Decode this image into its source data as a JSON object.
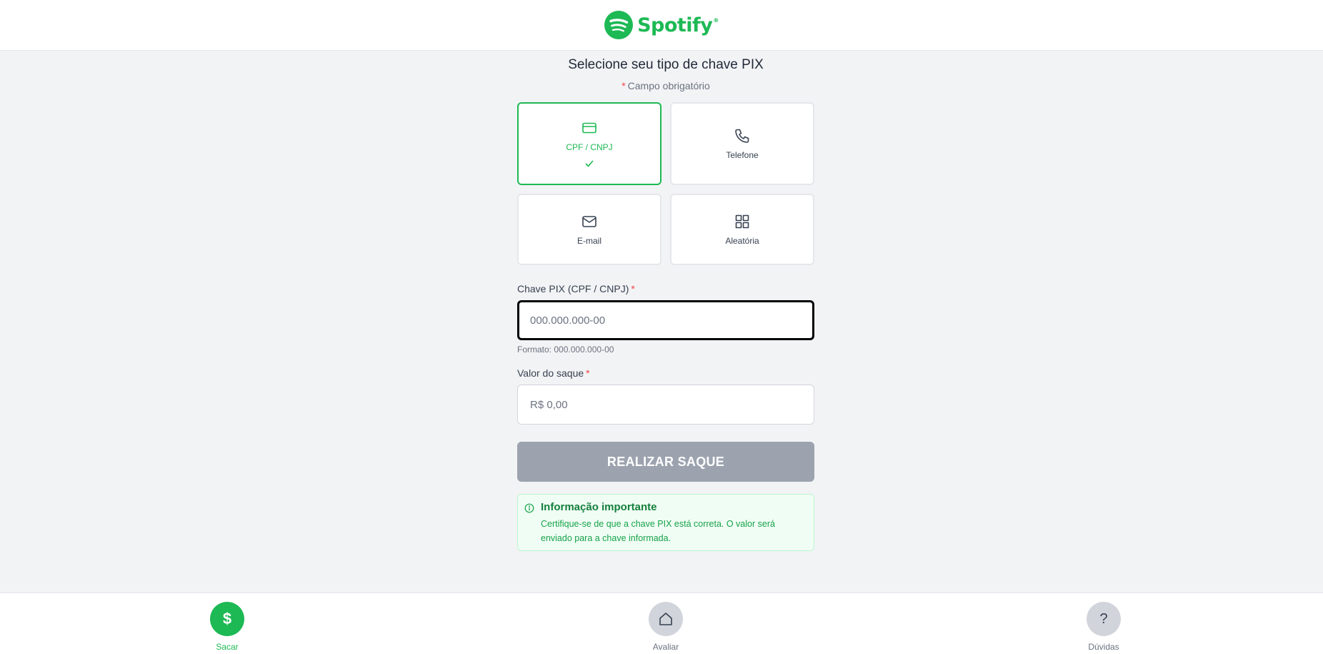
{
  "header": {
    "logo_text": "Spotify",
    "logo_mark": "®",
    "brand_color": "#1db954"
  },
  "form": {
    "title": "Selecione seu tipo de chave PIX",
    "required_star": "*",
    "required_note": "Campo obrigatório",
    "key_types": [
      {
        "label": "CPF / CNPJ",
        "icon": "credit-card-icon",
        "selected": true
      },
      {
        "label": "Telefone",
        "icon": "phone-icon",
        "selected": false
      },
      {
        "label": "E-mail",
        "icon": "mail-icon",
        "selected": false
      },
      {
        "label": "Aleatória",
        "icon": "grid-icon",
        "selected": false
      }
    ],
    "pix_key": {
      "label": "Chave PIX (CPF / CNPJ)",
      "placeholder": "000.000.000-00",
      "hint": "Formato: 000.000.000-00"
    },
    "amount": {
      "label": "Valor do saque",
      "placeholder": "R$ 0,00"
    },
    "submit_label": "REALIZAR SAQUE",
    "info": {
      "title": "Informação importante",
      "text": "Certifique-se de que a chave PIX está correta. O valor será enviado para a chave informada."
    }
  },
  "bottom_nav": {
    "items": [
      {
        "label": "Sacar",
        "icon": "dollar-icon",
        "glyph": "$",
        "active": true
      },
      {
        "label": "Avaliar",
        "icon": "home-icon",
        "active": false
      },
      {
        "label": "Dúvidas",
        "icon": "question-icon",
        "glyph": "?",
        "active": false
      }
    ]
  }
}
